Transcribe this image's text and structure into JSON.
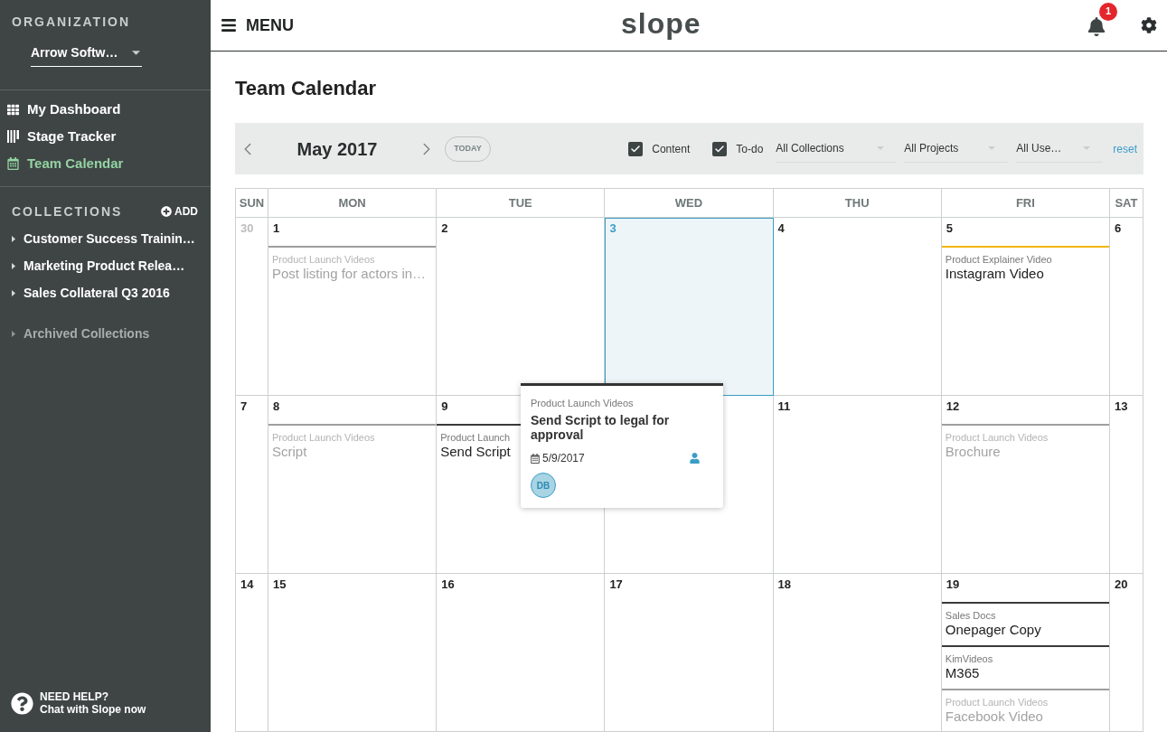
{
  "sidebar": {
    "organization_heading": "ORGANIZATION",
    "organization": "Arrow Softw…",
    "nav": [
      {
        "label": "My Dashboard",
        "kind": "dashboard",
        "selected": false
      },
      {
        "label": "Stage Tracker",
        "kind": "tracker",
        "selected": false
      },
      {
        "label": "Team Calendar",
        "kind": "calendar",
        "selected": true
      }
    ],
    "collections_heading": "COLLECTIONS",
    "add": "ADD",
    "collections": [
      "Customer Success Trainin…",
      "Marketing Product Relea…",
      "Sales Collateral Q3 2016"
    ],
    "archived": "Archived Collections",
    "help": {
      "title": "NEED HELP?",
      "subtitle": "Chat with Slope now"
    }
  },
  "header": {
    "menu": "MENU",
    "logo": "slope",
    "notification_count": "1"
  },
  "page_title": "Team Calendar",
  "toolbar": {
    "month": "May 2017",
    "today": "TODAY",
    "filters": [
      {
        "label": "Content",
        "checked": true
      },
      {
        "label": "To-do",
        "checked": true
      }
    ],
    "dropdowns": [
      "All Collections",
      "All Projects",
      "All Use…"
    ],
    "reset": "reset"
  },
  "calendar": {
    "weekdays": [
      "SUN",
      "MON",
      "TUE",
      "WED",
      "THU",
      "FRI",
      "SAT"
    ],
    "weeks": [
      {
        "previous_month_days": [
          {
            "number": "30"
          }
        ],
        "days": [
          {
            "number": "1",
            "today": false,
            "events": [
              {
                "category": "Product Launch Videos",
                "title": "Post listing for actors in…",
                "muted": true,
                "color": "#9e9e9e"
              }
            ]
          },
          {
            "number": "2",
            "today": false
          },
          {
            "number": "3",
            "today": true
          },
          {
            "number": "4",
            "today": false
          },
          {
            "number": "5",
            "today": false,
            "events": [
              {
                "category": "Product Explainer Video",
                "title": "Instagram Video",
                "muted": false,
                "color": "#f2b705"
              }
            ]
          },
          {
            "number": "6",
            "today": false
          }
        ]
      },
      {
        "days": [
          {
            "number": "7",
            "today": false
          },
          {
            "number": "8",
            "today": false,
            "events": [
              {
                "category": "Product Launch Videos",
                "title": "Script",
                "muted": true,
                "color": "#9e9e9e"
              }
            ]
          },
          {
            "number": "9",
            "today": false,
            "events": [
              {
                "category": "Product Launch",
                "title": "Send Script",
                "muted": false,
                "color": "#3a3a3a"
              }
            ]
          },
          {
            "today": false
          },
          {
            "number": "11",
            "today": false
          },
          {
            "number": "12",
            "today": false,
            "events": [
              {
                "category": "Product Launch Videos",
                "title": "Brochure",
                "muted": true,
                "color": "#9e9e9e"
              }
            ]
          },
          {
            "number": "13",
            "today": false
          }
        ]
      },
      {
        "days": [
          {
            "number": "14",
            "today": false
          },
          {
            "number": "15",
            "today": false
          },
          {
            "number": "16",
            "today": false
          },
          {
            "number": "17",
            "today": false
          },
          {
            "number": "18",
            "today": false
          },
          {
            "number": "19",
            "today": false,
            "events": [
              {
                "category": "Sales Docs",
                "title": "Onepager Copy",
                "muted": false,
                "color": "#3a3a3a"
              },
              {
                "category": "KimVideos",
                "title": "M365",
                "muted": false,
                "color": "#3a3a3a"
              },
              {
                "category": "Product Launch Videos",
                "title": "Facebook Video",
                "muted": true,
                "color": "#9e9e9e"
              }
            ]
          },
          {
            "number": "20",
            "today": false
          }
        ]
      }
    ],
    "popover": {
      "category": "Product Launch Videos",
      "title": "Send Script to legal for approval",
      "date": "5/9/2017",
      "assignee": "DB"
    }
  }
}
